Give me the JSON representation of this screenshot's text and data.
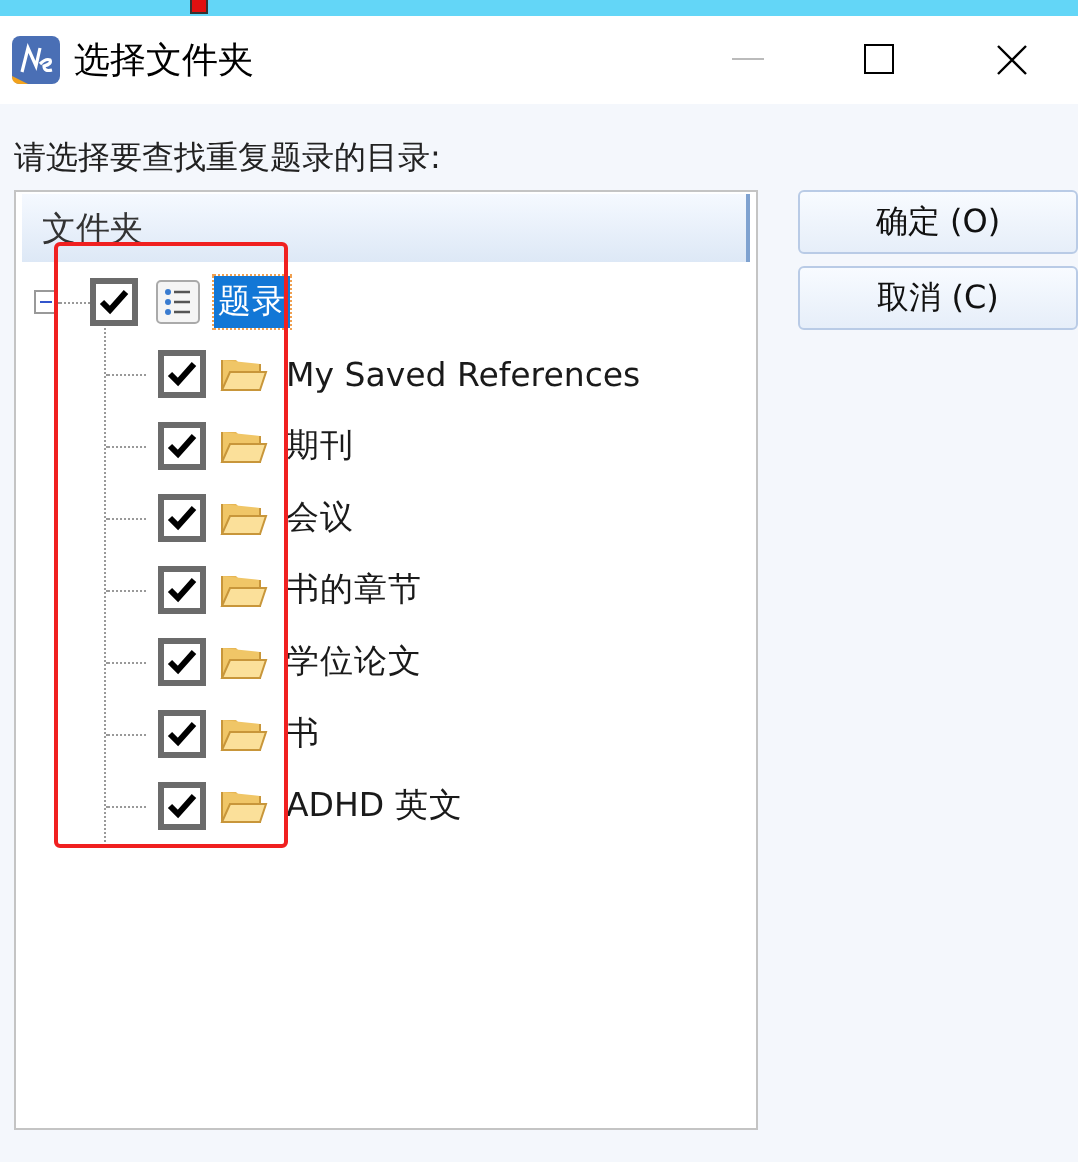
{
  "window": {
    "title": "选择文件夹"
  },
  "prompt": "请选择要查找重复题录的目录:",
  "tree": {
    "header": "文件夹",
    "items": [
      {
        "label": "题录",
        "kind": "library",
        "checked": true,
        "expanded": true,
        "selected": true,
        "children": [
          {
            "label": "My Saved References",
            "kind": "folder",
            "checked": true,
            "selected": false
          },
          {
            "label": "期刊",
            "kind": "folder",
            "checked": true,
            "selected": false
          },
          {
            "label": "会议",
            "kind": "folder",
            "checked": true,
            "selected": false
          },
          {
            "label": "书的章节",
            "kind": "folder",
            "checked": true,
            "selected": false
          },
          {
            "label": "学位论文",
            "kind": "folder",
            "checked": true,
            "selected": false
          },
          {
            "label": "书",
            "kind": "folder",
            "checked": true,
            "selected": false
          },
          {
            "label": "ADHD 英文",
            "kind": "folder",
            "checked": true,
            "selected": false
          }
        ]
      }
    ]
  },
  "buttons": [
    {
      "label": "确定 (O)"
    },
    {
      "label": "取消 (C)"
    }
  ]
}
